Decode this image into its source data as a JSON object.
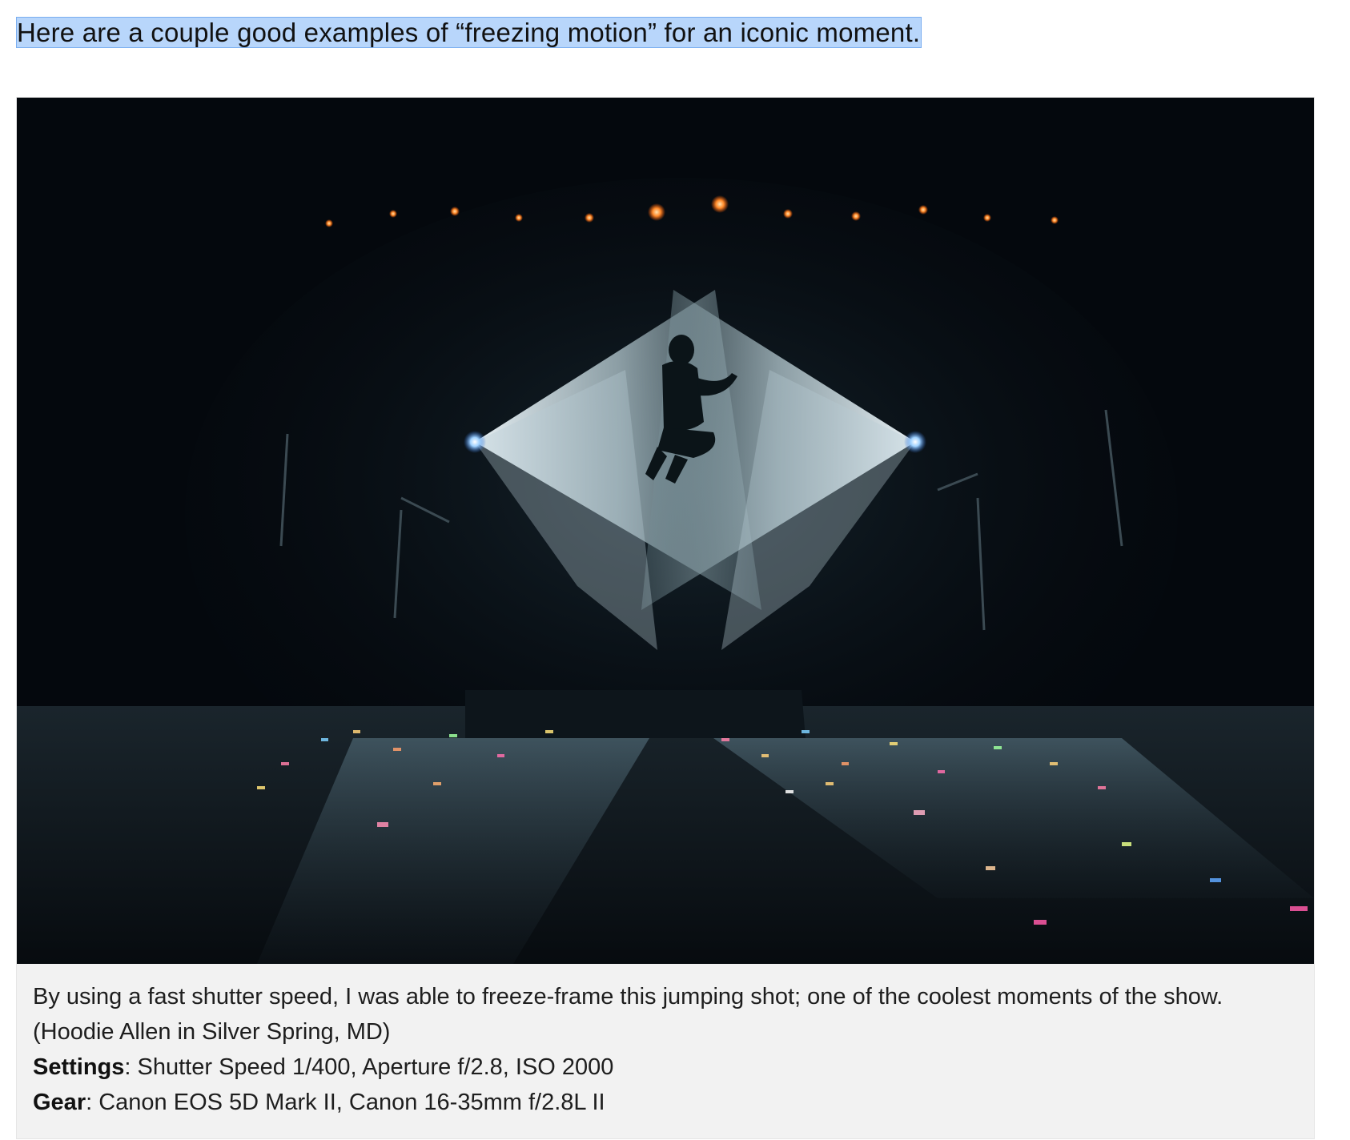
{
  "intro": {
    "text": "Here are a couple good examples of “freezing motion” for an iconic moment."
  },
  "figure": {
    "caption": "By using a fast shutter speed, I was able to freeze-frame this jumping shot; one of the coolest moments of the show. (Hoodie Allen in Silver Spring, MD)",
    "settings_label": "Settings",
    "settings_value": ": Shutter Speed 1/400, Aperture f/2.8, ISO 2000",
    "gear_label": "Gear",
    "gear_value": ": Canon EOS 5D Mark II, Canon 16-35mm f/2.8L II"
  },
  "colors": {
    "selection_highlight": "#b8d6fb",
    "caption_background": "#f2f2f2",
    "photo_background": "#04080d",
    "spotlight": "#d8e6ea"
  }
}
